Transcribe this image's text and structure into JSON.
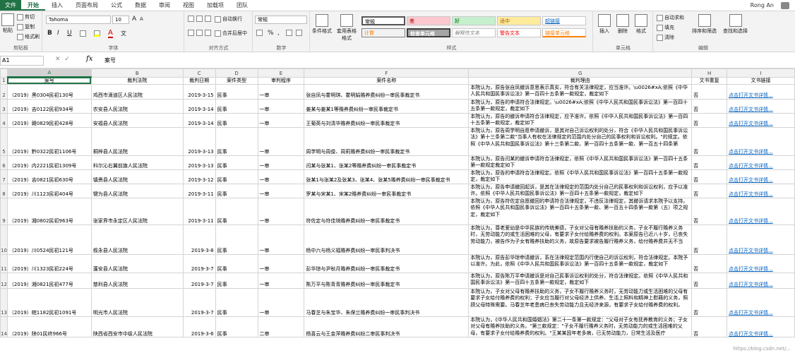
{
  "tabs": {
    "file": "文件",
    "home": "开始",
    "insert": "插入",
    "layout": "页面布局",
    "formulas": "公式",
    "data": "数据",
    "review": "审阅",
    "view": "视图",
    "addins": "加载项",
    "team": "团队"
  },
  "user": "Rong An",
  "clipboard": {
    "paste": "粘贴",
    "cut": "剪切",
    "copy": "复制",
    "format_painter": "格式刷",
    "label": "剪贴板"
  },
  "font": {
    "name": "Tahoma",
    "size": "10",
    "bold": "B",
    "italic": "I",
    "underline": "U",
    "label": "字体",
    "grow": "A",
    "shrink": "A",
    "color_letter": "A",
    "wen": "文"
  },
  "alignment": {
    "wrap": "自动换行",
    "merge": "合并后居中",
    "label": "对齐方式"
  },
  "number": {
    "format": "常规",
    "label": "数字",
    "percent": "%",
    "comma": ","
  },
  "styles": {
    "cond": "条件格式",
    "table": "套用表格格式",
    "cells": [
      "常规",
      "差",
      "好",
      "适中",
      "超链接",
      "计算",
      "检查单元格",
      "解释性文本",
      "警告文本",
      "链接单元格"
    ],
    "label": "样式"
  },
  "cells_grp": {
    "insert": "插入",
    "delete": "删除",
    "format": "格式",
    "label": "单元格"
  },
  "editing": {
    "autosum": "自动求和",
    "fill": "填充",
    "clear": "清除",
    "sort": "排序和筛选",
    "find": "查找和选择",
    "label": "编辑"
  },
  "formula_bar": {
    "name": "A1",
    "content": "案号",
    "fx": "fx"
  },
  "columns": [
    "A",
    "B",
    "C",
    "D",
    "E",
    "F",
    "G",
    "H",
    "I"
  ],
  "headers": [
    "案号",
    "裁判法院",
    "裁判日期",
    "案件类型",
    "审判程序",
    "案件名称",
    "裁判理由",
    "文书重复",
    "文书链接"
  ],
  "rows": [
    {
      "n": "2",
      "a": "（2019）黑0304民初130号",
      "b": "鸡西市滴道区人民法院",
      "c": "2019-3-15",
      "d": "民事",
      "e": "一审",
      "f": "张自凤与霍明琪、霍明娟赡养费纠纷一审民事裁定书",
      "g": "本院认为，原告张自凤撤诉意思表示真实，符合有关法律规定，应当准许。\\u0026#xA;依照《中华人民共和国民事诉讼法》第一百四十五条第一款规定，裁定如下",
      "h": "否",
      "i": "点击打开文书详情..."
    },
    {
      "n": "3",
      "a": "（2019）吉0122民初934号",
      "b": "农安县人民法院",
      "c": "2019-3-14",
      "d": "民事",
      "e": "一审",
      "f": "姜某与姜某1等赡养费纠纷一审民事裁定书",
      "g": "本院认为，原告的申请符合法律规定。\\u0026#xA;依照《中华人民共和国民事诉讼法》第一百四十五条第一款规定，裁定如下",
      "h": "否",
      "i": "点击打开文书详情..."
    },
    {
      "n": "4",
      "a": "（2019）赣0829民初428号",
      "b": "安福县人民法院",
      "c": "2019-3-14",
      "d": "民事",
      "e": "一审",
      "f": "王菊英与刘清华赡养费纠纷一审民事裁定书",
      "g": "本院认为，原告的撤诉申请符合法律规定，应予准许。依照《中华人民共和国民事诉讼法》第一百四十五条第一款规定，裁定如下",
      "h": "否",
      "i": "点击打开文书详情..."
    },
    {
      "n": "5",
      "a": "（2019）黔0322民初1106号",
      "b": "桐梓县人民法院",
      "c": "2019-3-13",
      "d": "民事",
      "e": "一审",
      "f": "周学明与周俊、周莉赡养费纠纷一审民事裁定书",
      "g": "本院认为，原告周学明自愿申请撤诉，是其对自己诉讼权利的处分，符合《中华人民共和国民事诉讼法》第十三条第二款\"当事人有权在法律规定的范围内处分自己的民事权利和诉讼权利。\"的规定。依照《中华人民共和国民事诉讼法》第十三条第二款、第一百四十五条第一款、第一百五十四条第",
      "h": "否",
      "i": "点击打开文书详情..."
    },
    {
      "n": "6",
      "a": "（2019）内2221民初1309号",
      "b": "科尔沁右翼前旗人民法院",
      "c": "2019-3-13",
      "d": "民事",
      "e": "一审",
      "f": "闫某与张某1、张某2等赡养费纠纷一审民事裁定书",
      "g": "本院认为，原告闫某的撤诉申请符合法律规定，依照《中华人民共和国民事诉讼法》第一百四十五条第一款规定裁定如下",
      "h": "否",
      "i": "点击打开文书详情..."
    },
    {
      "n": "7",
      "a": "（2019）吉0821民初630号",
      "b": "镇赉县人民法院",
      "c": "2019-3-12",
      "d": "民事",
      "e": "一审",
      "f": "张某1与张某2及张某3、张某4、张某5赡养费纠纷一审民事裁定书",
      "g": "本院认为，原告的申请符合法律规定。依照《中华人民共和国民事诉讼法》第一百四十五条第一款规定，裁定如下",
      "h": "否",
      "i": "点击打开文书详情..."
    },
    {
      "n": "8",
      "a": "（2019）川1123民初404号",
      "b": "犍为县人民法院",
      "c": "2019-3-11",
      "d": "民事",
      "e": "一审",
      "f": "罗某与宋某1、宋某2赡养费纠纷一审民事裁定书",
      "g": "本院认为，原告申请撤回起诉，是其在法律规定的范围内处分自己的民事权利和诉讼权利，应予以准许。依照《中华人民共和国民事诉讼法》第一百四十五条第一款规定，裁定如下",
      "h": "否",
      "i": "点击打开文书详情..."
    },
    {
      "n": "9",
      "a": "（2019）湘0802民初963号",
      "b": "张家界市永定区人民法院",
      "c": "2019-3-11",
      "d": "民事",
      "e": "一审",
      "f": "符佐定与符佳琦赡养费纠纷一审民事裁定书",
      "g": "本院认为，原告符佐定自愿撤回的申请符合法律规定，不违反法律规定，其撤诉请求本院予以支持。依照《中华人民共和国民事诉讼法》第一百四十五条第一款、第一百五十四条第一款第（五）项之规定，裁定如下",
      "h": "否",
      "i": "点击打开文书详情..."
    },
    {
      "n": "10",
      "a": "（2019）川0524民初121号",
      "b": "叙永县人民法院",
      "c": "2019-3-8",
      "d": "民事",
      "e": "一审",
      "f": "杨中六与杨义福赡养费纠纷一审民事判决书",
      "g": "本院认为，尊老爱幼是中华民族的传统美德，子女对父母有赡养扶助的义务，子女不履行赡养义务时，无劳动能力的或生活困难的父母，有要求子女付给赡养费的权利。本案原告已近八十岁，已丧失劳动能力，被告作为子女有赡养扶助的义务，故原告要求被告履行赡养义务，给付赡养费并无不当",
      "h": "否",
      "i": "点击打开文书详情..."
    },
    {
      "n": "11",
      "a": "（2019）川1323民初224号",
      "b": "蓬安县人民法院",
      "c": "2019-3-7",
      "d": "民事",
      "e": "一审",
      "f": "彭华琼与尹秋月赡养费纠纷一审民事裁定书",
      "g": "本院认为，原告彭华琼申请撤诉，系在法律规定范围内行使自己的诉讼权利，符合法律规定。本院予以准许。为此，依照《中华人民共和国民事诉讼法》第一百四十五条第一款规定，裁定如下",
      "h": "否",
      "i": "点击打开文书详情..."
    },
    {
      "n": "12",
      "a": "（2019）湘0821民初477号",
      "b": "慈利县人民法院",
      "c": "2019-3-7",
      "d": "民事",
      "e": "一审",
      "f": "陈万平与陈青青赡养费纠纷一审民事裁定书",
      "g": "本院认为，原告陈万平申请撤诉是对自己民事诉讼权利的处分，符合法律规定。依照《中华人民共和国民事诉讼法》第一百四十五条第一款规定，裁定如下",
      "h": "否",
      "i": "点击打开文书详情..."
    },
    {
      "n": "13",
      "a": "（2019）皖1182民初1091号",
      "b": "明光市人民法院",
      "c": "2019-3-7",
      "d": "民事",
      "e": "一审",
      "f": "马春芝与朱宝华、朱保兰赡养费纠纷一审民事判决书",
      "g": "本院认为，子女对父母有赡养扶助的义务，子女不履行赡养义务时，无劳动能力或生活困难的父母有要求子女给付赡养费的权利；子女应当履行对父母经济上供养、生活上照料和精神上慰藉的义务，照顾父母特殊需要。马春芝年老患病已丧失劳动能力且无经济来源，有要求子女给付赡养费的权利。",
      "h": "否",
      "i": "点击打开文书详情..."
    },
    {
      "n": "14",
      "a": "（2019）陕01民终966号",
      "b": "陕西省西安市中级人民法院",
      "c": "2019-3-6",
      "d": "民事",
      "e": "二审",
      "f": "杨喜云与王金萍赡养费纠纷二审民事判决书",
      "g": "本院认为，《中华人民共和国婚姻法》第二十一条第一款规定：\"父母对子女有抚养教育的义务；子女对父母有赡养扶助的义务。\"第三款规定：\"子女不履行赡养义务时，无劳动能力的或生活困难的父母，有要求子女付给赡养费的权利。\"王某某因年老多病，已无劳动能力，日常生活及医疗",
      "h": "否",
      "i": "点击打开文书详情..."
    }
  ],
  "watermark": "https://blog.csdn.net/..."
}
